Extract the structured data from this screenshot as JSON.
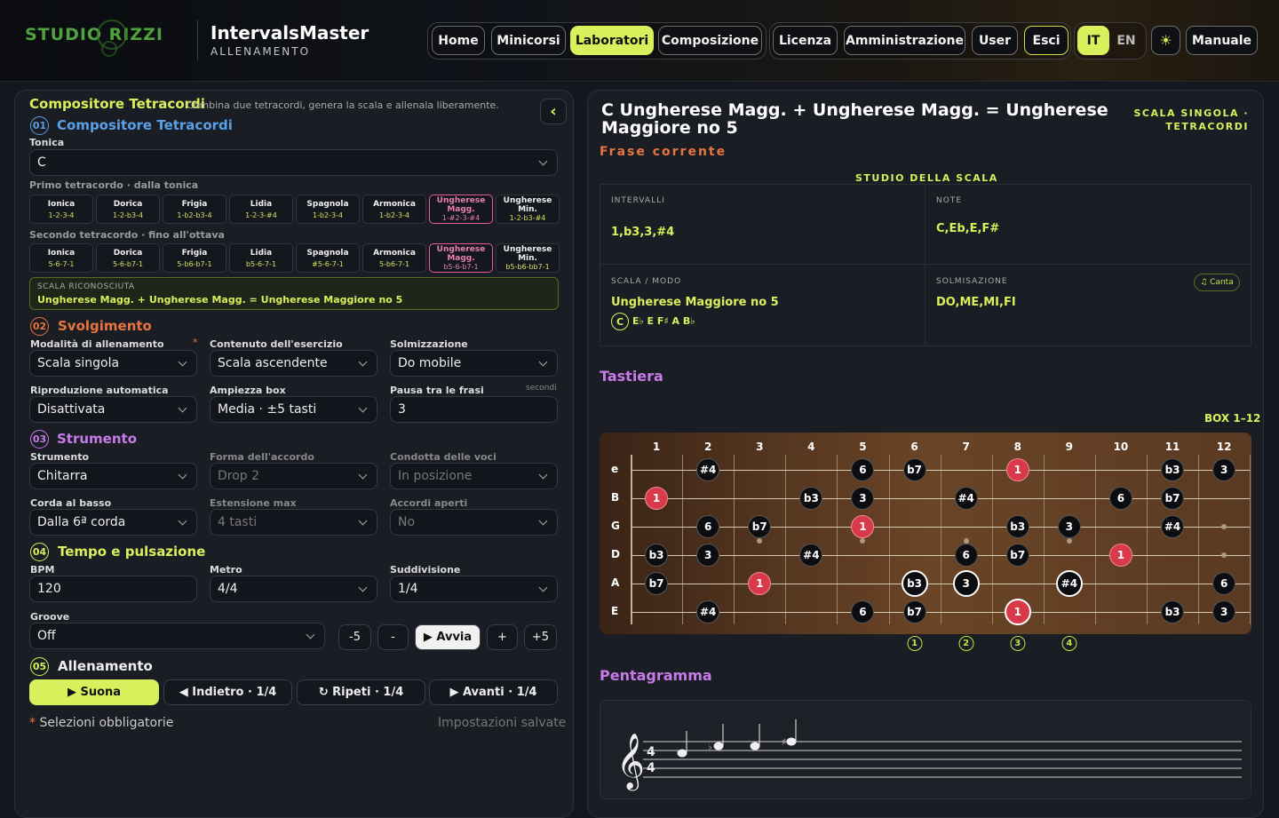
{
  "header": {
    "logo": "STUDIO RIZZI",
    "app_title": "IntervalsMaster",
    "app_sub": "ALLENAMENTO",
    "nav": [
      "Home",
      "Minicorsi",
      "Laboratori",
      "Composizione",
      "Licenza",
      "Amministrazione",
      "User",
      "Esci",
      "Manuale"
    ],
    "lang_it": "IT",
    "lang_en": "EN",
    "theme_icon": "☀"
  },
  "left": {
    "title": "Compositore Tetracordi",
    "subtitle": "Combina due tetracordi, genera la scala e allenala liberamente.",
    "collapse": "‹",
    "s1": {
      "num": "01",
      "title": "Compositore Tetracordi",
      "tonic_label": "Tonica",
      "tonic": "C",
      "first_label": "Primo tetracordo · dalla tonica",
      "second_label": "Secondo tetracordo · fino all'ottava",
      "first": [
        {
          "n": "Ionica",
          "s": "1-2-3-4"
        },
        {
          "n": "Dorica",
          "s": "1-2-b3-4"
        },
        {
          "n": "Frigia",
          "s": "1-b2-b3-4"
        },
        {
          "n": "Lidia",
          "s": "1-2-3-#4"
        },
        {
          "n": "Spagnola",
          "s": "1-b2-3-4"
        },
        {
          "n": "Armonica",
          "s": "1-b2-3-4"
        },
        {
          "n": "Ungherese Magg.",
          "s": "1-#2-3-#4"
        },
        {
          "n": "Ungherese Min.",
          "s": "1-2-b3-#4"
        }
      ],
      "second": [
        {
          "n": "Ionica",
          "s": "5-6-7-1"
        },
        {
          "n": "Dorica",
          "s": "5-6-b7-1"
        },
        {
          "n": "Frigia",
          "s": "5-b6-b7-1"
        },
        {
          "n": "Lidia",
          "s": "b5-6-7-1"
        },
        {
          "n": "Spagnola",
          "s": "#5-6-7-1"
        },
        {
          "n": "Armonica",
          "s": "5-b6-7-1"
        },
        {
          "n": "Ungherese Magg.",
          "s": "b5-6-b7-1"
        },
        {
          "n": "Ungherese Min.",
          "s": "b5-b6-bb7-1"
        }
      ],
      "recog_label": "SCALA RICONOSCIUTA",
      "recog": "Ungherese Magg. + Ungherese Magg. = Ungherese Maggiore no 5"
    },
    "s2": {
      "num": "02",
      "title": "Svolgimento",
      "mode_label": "Modalità di allenamento",
      "mode": "Scala singola",
      "content_label": "Contenuto dell'esercizio",
      "content": "Scala ascendente",
      "solm_label": "Solmizzazione",
      "solm": "Do mobile",
      "auto_label": "Riproduzione automatica",
      "auto": "Disattivata",
      "box_label": "Ampiezza box",
      "box": "Media · ±5 tasti",
      "pause_label": "Pausa tra le frasi",
      "pause_unit": "secondi",
      "pause": "3"
    },
    "s3": {
      "num": "03",
      "title": "Strumento",
      "instr_label": "Strumento",
      "instr": "Chitarra",
      "shape_label": "Forma dell'accordo",
      "shape": "Drop 2",
      "voice_label": "Condotta delle voci",
      "voice": "In posizione",
      "bass_label": "Corda al basso",
      "bass": "Dalla 6ª corda",
      "ext_label": "Estensione max",
      "ext": "4 tasti",
      "open_label": "Accordi aperti",
      "open": "No"
    },
    "s4": {
      "num": "04",
      "title": "Tempo e pulsazione",
      "bpm_label": "BPM",
      "bpm": "120",
      "metro_label": "Metro",
      "metro": "4/4",
      "sub_label": "Suddivisione",
      "sub": "1/4",
      "groove_label": "Groove",
      "groove": "Off",
      "m5": "-5",
      "m1": "-",
      "start": "▶ Avvia",
      "p1": "+",
      "p5": "+5"
    },
    "s5": {
      "num": "05",
      "title": "Allenamento",
      "play": "▶ Suona",
      "back": "◀ Indietro · 1/4",
      "repeat": "↻ Ripeti · 1/4",
      "fwd": "▶ Avanti · 1/4"
    },
    "required": "Selezioni obbligatorie",
    "saved": "Impostazioni salvate"
  },
  "right": {
    "title_line1": "C Ungherese Magg. + Ungherese Magg. = Ungherese",
    "title_line2": "Maggiore no 5",
    "badge1": "SCALA SINGOLA ·",
    "badge2": "TETRACORDI",
    "phrase": "Frase corrente",
    "study": "STUDIO DELLA SCALA",
    "intervals_label": "INTERVALLI",
    "intervals": "1,b3,3,#4",
    "notes_label": "NOTE",
    "notes": "C,Eb,E,F#",
    "scale_label": "SCALA / MODO",
    "scale": "Ungherese Maggiore no 5",
    "scale_root": "C",
    "scale_notes": "E♭ E F♯ A B♭",
    "solm_label": "SOLMISAZIONE",
    "solm": "DO,ME,MI,FI",
    "sing": "♫ Canta",
    "keyboard": "Tastiera",
    "box": "BOX 1–12",
    "staff": "Pentagramma",
    "frets": [
      "1",
      "2",
      "3",
      "4",
      "5",
      "6",
      "7",
      "8",
      "9",
      "10",
      "11",
      "12"
    ],
    "strings": [
      "e",
      "B",
      "G",
      "D",
      "A",
      "E"
    ],
    "fingers": [
      "1",
      "2",
      "3",
      "4"
    ]
  },
  "fretboard": [
    {
      "s": 0,
      "f": 2,
      "t": "#4"
    },
    {
      "s": 0,
      "f": 5,
      "t": "6"
    },
    {
      "s": 0,
      "f": 6,
      "t": "b7"
    },
    {
      "s": 0,
      "f": 8,
      "t": "1",
      "root": true
    },
    {
      "s": 0,
      "f": 11,
      "t": "b3"
    },
    {
      "s": 0,
      "f": 12,
      "t": "3"
    },
    {
      "s": 1,
      "f": 1,
      "t": "1",
      "root": true
    },
    {
      "s": 1,
      "f": 4,
      "t": "b3"
    },
    {
      "s": 1,
      "f": 5,
      "t": "3"
    },
    {
      "s": 1,
      "f": 7,
      "t": "#4"
    },
    {
      "s": 1,
      "f": 10,
      "t": "6"
    },
    {
      "s": 1,
      "f": 11,
      "t": "b7"
    },
    {
      "s": 2,
      "f": 2,
      "t": "6"
    },
    {
      "s": 2,
      "f": 3,
      "t": "b7"
    },
    {
      "s": 2,
      "f": 5,
      "t": "1",
      "root": true
    },
    {
      "s": 2,
      "f": 8,
      "t": "b3"
    },
    {
      "s": 2,
      "f": 9,
      "t": "3"
    },
    {
      "s": 2,
      "f": 11,
      "t": "#4"
    },
    {
      "s": 3,
      "f": 1,
      "t": "b3"
    },
    {
      "s": 3,
      "f": 2,
      "t": "3"
    },
    {
      "s": 3,
      "f": 4,
      "t": "#4"
    },
    {
      "s": 3,
      "f": 7,
      "t": "6"
    },
    {
      "s": 3,
      "f": 8,
      "t": "b7"
    },
    {
      "s": 3,
      "f": 10,
      "t": "1",
      "root": true
    },
    {
      "s": 4,
      "f": 1,
      "t": "b7"
    },
    {
      "s": 4,
      "f": 3,
      "t": "1",
      "root": true
    },
    {
      "s": 4,
      "f": 6,
      "t": "b3",
      "ring": true
    },
    {
      "s": 4,
      "f": 7,
      "t": "3",
      "ring": true
    },
    {
      "s": 4,
      "f": 9,
      "t": "#4",
      "ring": true
    },
    {
      "s": 4,
      "f": 12,
      "t": "6"
    },
    {
      "s": 5,
      "f": 2,
      "t": "#4"
    },
    {
      "s": 5,
      "f": 5,
      "t": "6"
    },
    {
      "s": 5,
      "f": 6,
      "t": "b7"
    },
    {
      "s": 5,
      "f": 8,
      "t": "1",
      "root": true,
      "ring": true
    },
    {
      "s": 5,
      "f": 11,
      "t": "b3"
    },
    {
      "s": 5,
      "f": 12,
      "t": "3"
    }
  ],
  "colors": {
    "accent": "#d8f05c",
    "root": "#d93a4a",
    "blue": "#5aa0e8",
    "orange": "#e8743e",
    "purple": "#c77be8"
  }
}
